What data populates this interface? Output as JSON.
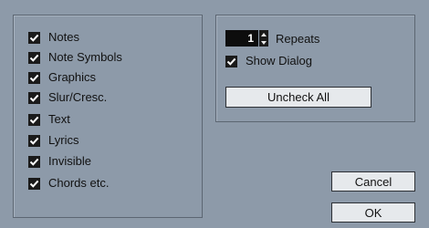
{
  "left_panel": {
    "items": [
      {
        "label": "Notes",
        "checked": true
      },
      {
        "label": "Note Symbols",
        "checked": true
      },
      {
        "label": "Graphics",
        "checked": true
      },
      {
        "label": "Slur/Cresc.",
        "checked": true
      },
      {
        "label": "Text",
        "checked": true
      },
      {
        "label": "Lyrics",
        "checked": true
      },
      {
        "label": "Invisible",
        "checked": true
      },
      {
        "label": "Chords etc.",
        "checked": true
      }
    ]
  },
  "right_panel": {
    "repeats_value": "1",
    "repeats_label": "Repeats",
    "show_dialog_label": "Show Dialog",
    "show_dialog_checked": true,
    "uncheck_all_label": "Uncheck All"
  },
  "buttons": {
    "cancel_label": "Cancel",
    "ok_label": "OK"
  },
  "colors": {
    "background": "#8d9aa9",
    "button": "#e6e9ec",
    "checkbox": "#1a1a1a"
  }
}
